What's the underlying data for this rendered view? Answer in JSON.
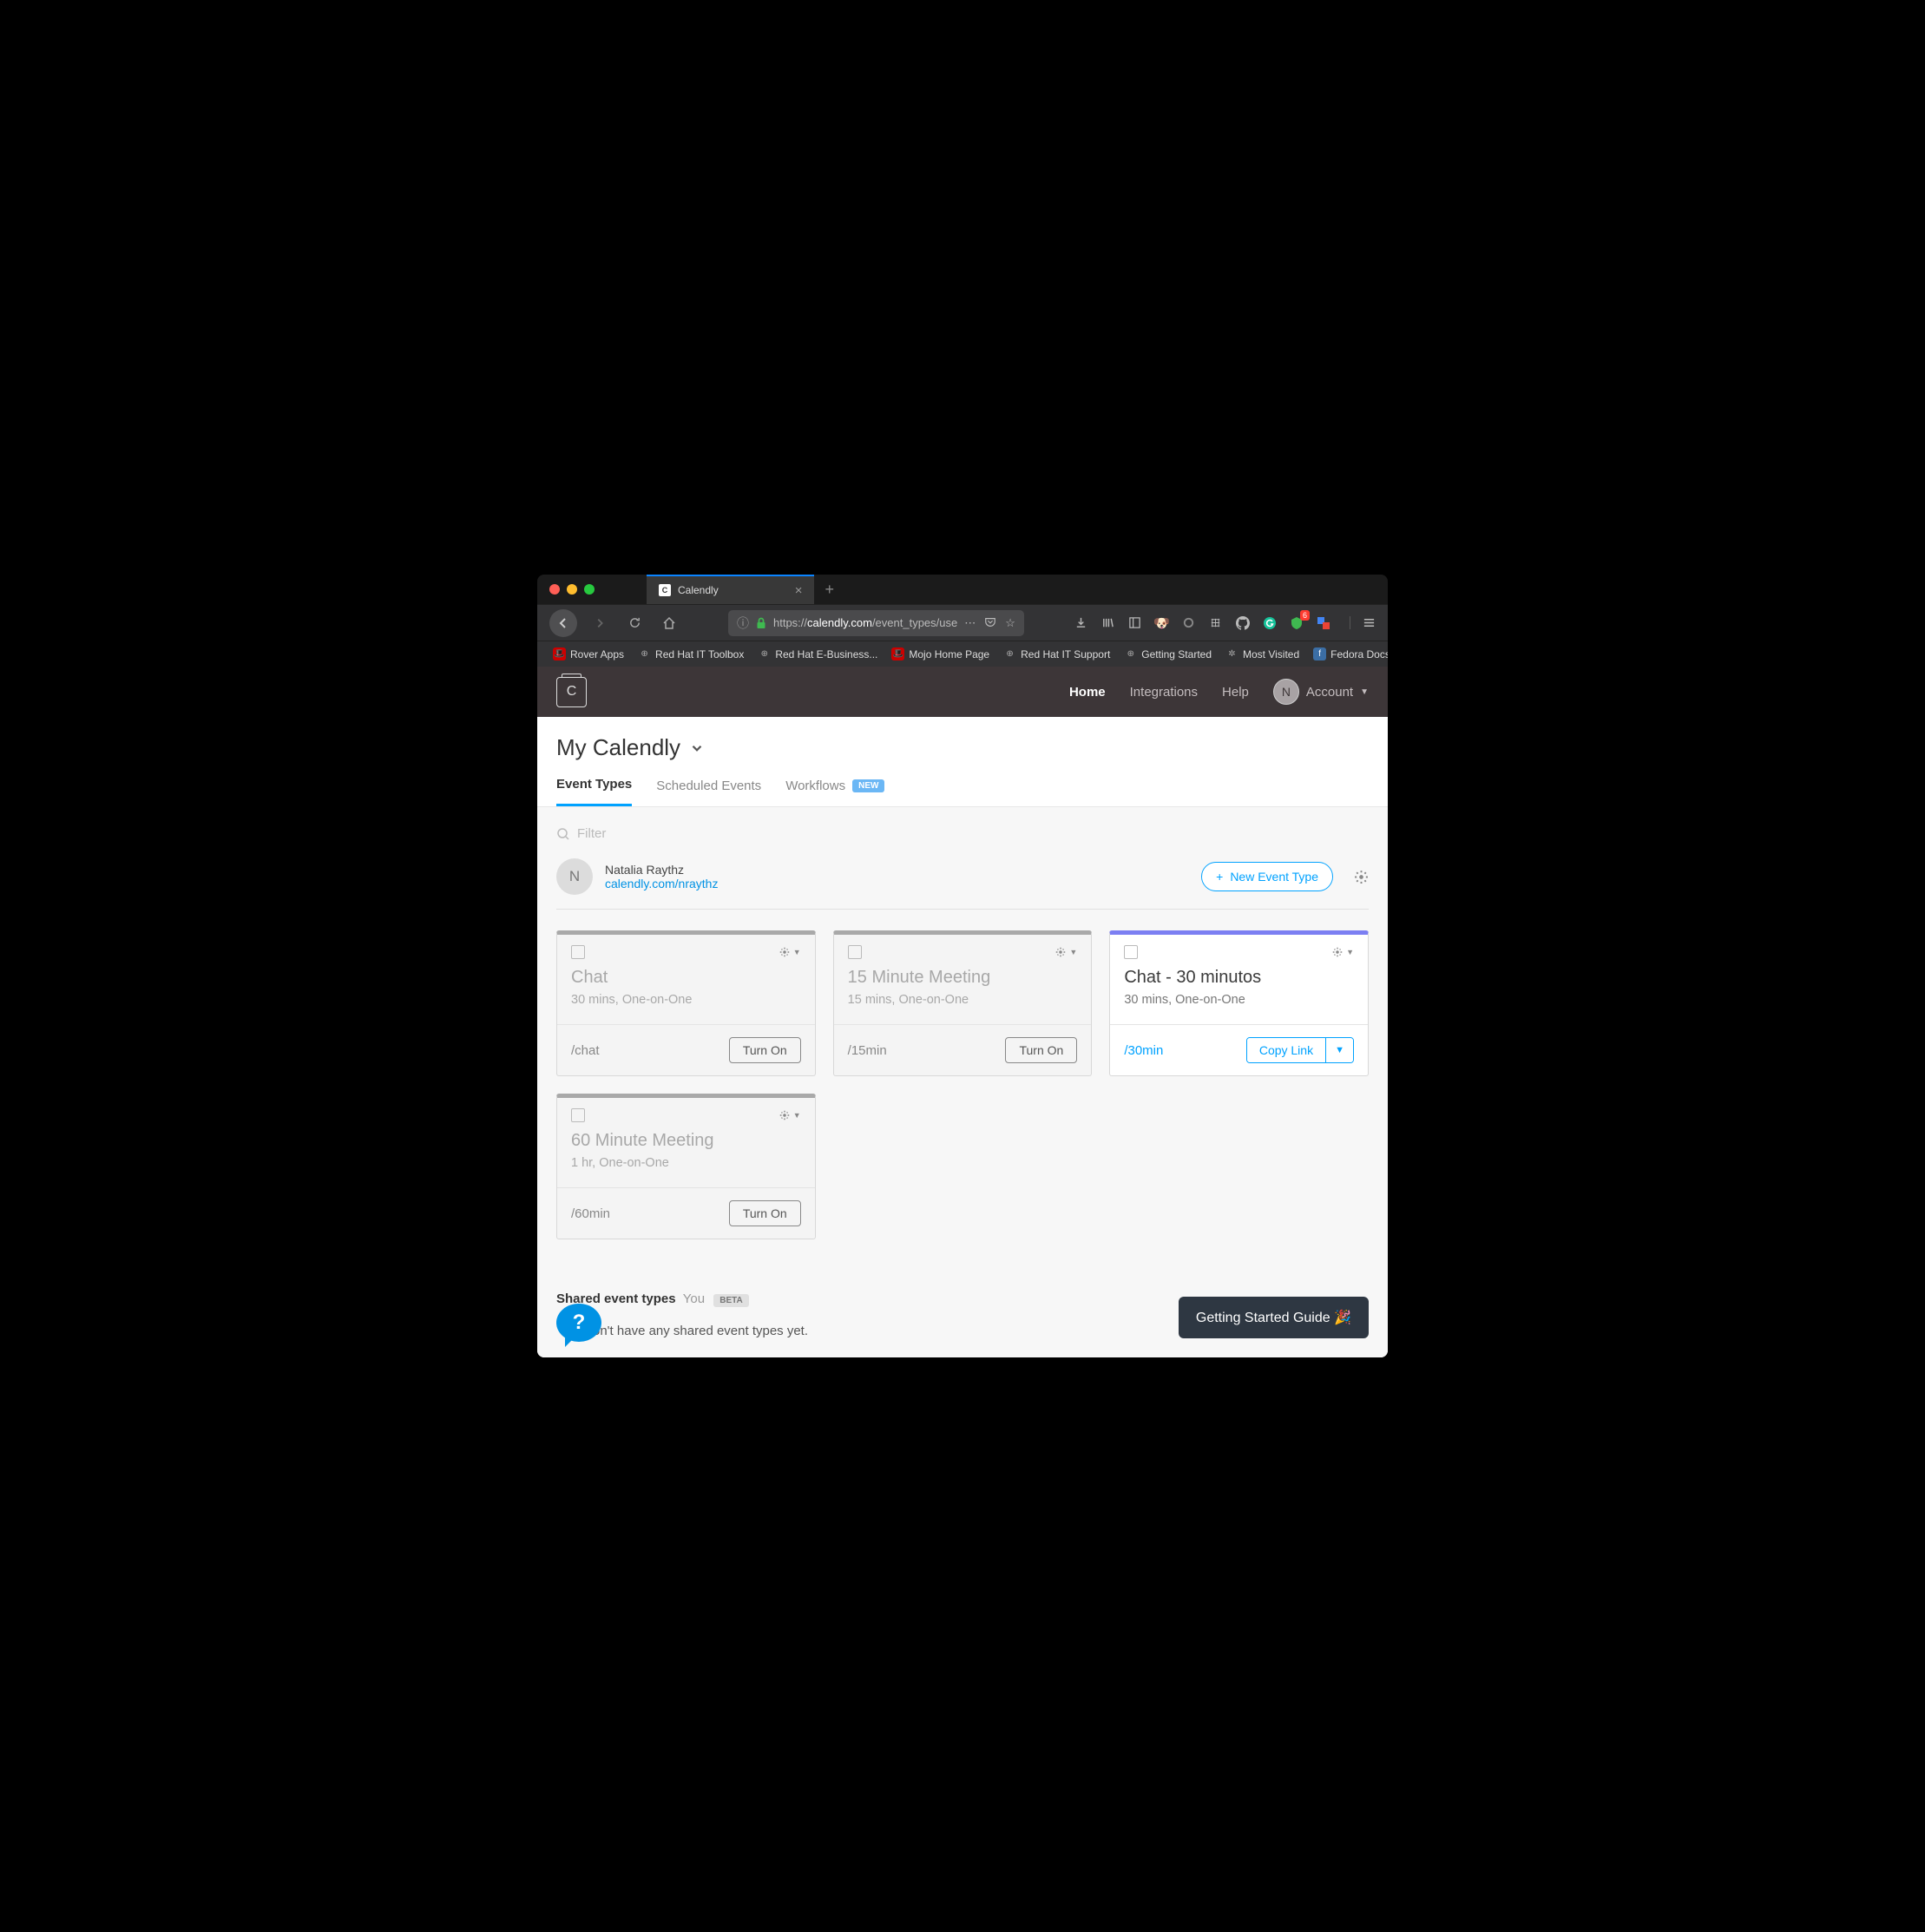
{
  "browser": {
    "tab_title": "Calendly",
    "url_proto": "https://",
    "url_domain": "calendly.com",
    "url_path": "/event_types/use",
    "bookmarks": [
      "Rover Apps",
      "Red Hat IT Toolbox",
      "Red Hat E-Business...",
      "Mojo Home Page",
      "Red Hat IT Support",
      "Getting Started",
      "Most Visited",
      "Fedora Docs"
    ],
    "ext_badge": "6"
  },
  "header": {
    "logo_letter": "C",
    "nav": {
      "home": "Home",
      "integrations": "Integrations",
      "help": "Help",
      "account": "Account"
    },
    "avatar_letter": "N"
  },
  "page": {
    "title": "My Calendly",
    "tabs": {
      "event_types": "Event Types",
      "scheduled": "Scheduled Events",
      "workflows": "Workflows",
      "new_badge": "NEW"
    },
    "filter_placeholder": "Filter"
  },
  "user": {
    "avatar_letter": "N",
    "name": "Natalia Raythz",
    "link": "calendly.com/nraythz",
    "new_event_btn": "New Event Type"
  },
  "cards": [
    {
      "title": "Chat",
      "meta": "30 mins, One-on-One",
      "slug": "/chat",
      "action": "Turn On",
      "active": false
    },
    {
      "title": "15 Minute Meeting",
      "meta": "15 mins, One-on-One",
      "slug": "/15min",
      "action": "Turn On",
      "active": false
    },
    {
      "title": "Chat - 30 minutos",
      "meta": "30 mins, One-on-One",
      "slug": "/30min",
      "action": "Copy Link",
      "active": true
    },
    {
      "title": "60 Minute Meeting",
      "meta": "1 hr, One-on-One",
      "slug": "/60min",
      "action": "Turn On",
      "active": false
    }
  ],
  "shared": {
    "title": "Shared event types",
    "you": "You",
    "beta": "BETA",
    "empty": "on't have any shared event types yet."
  },
  "guide_btn": "Getting Started Guide 🎉"
}
